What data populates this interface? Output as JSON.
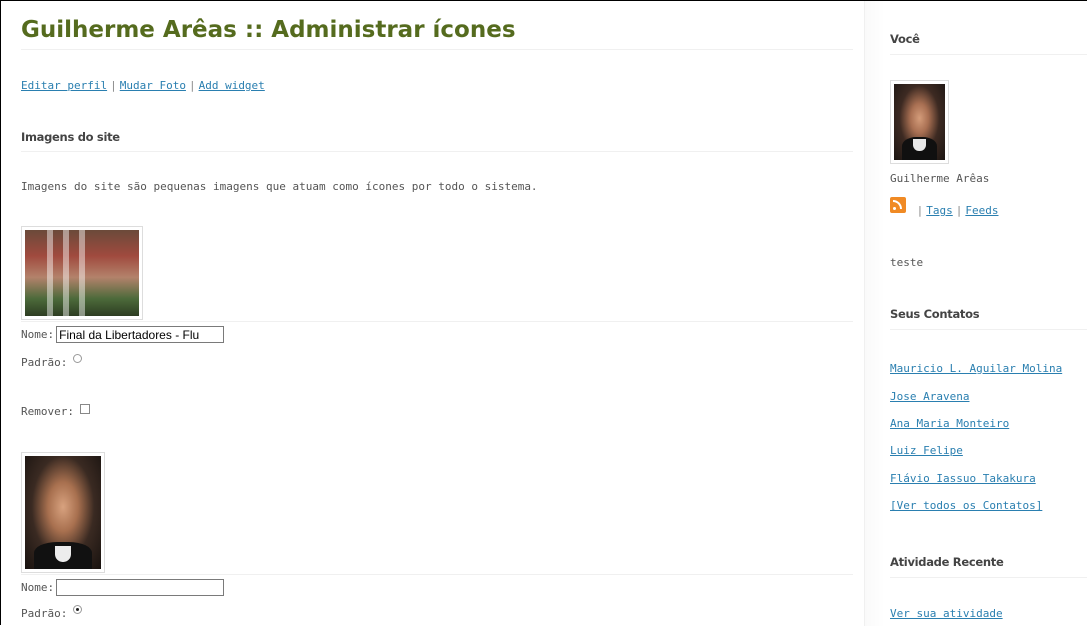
{
  "page": {
    "title": "Guilherme Arêas :: Administrar ícones"
  },
  "toplinks": {
    "edit_profile": "Editar perfil",
    "change_photo": "Mudar Foto",
    "add_widget": "Add widget",
    "separator": "|"
  },
  "section": {
    "title": "Imagens do site",
    "description": "Imagens do site são pequenas imagens que atuam como ícones por todo o sistema."
  },
  "icons": [
    {
      "name_label": "Nome:",
      "name_value": "Final da Libertadores - Flu",
      "default_label": "Padrão:",
      "default_checked": false,
      "remove_label": "Remover:"
    },
    {
      "name_label": "Nome:",
      "name_value": "",
      "default_label": "Padrão:",
      "default_checked": true
    }
  ],
  "sidebar": {
    "you_title": "Você",
    "user_name": "Guilherme Arêas",
    "tags_link": "Tags",
    "feeds_link": "Feeds",
    "separator": "|",
    "status_text": "teste",
    "contacts_title": "Seus Contatos",
    "contacts": [
      "Mauricio L. Aguilar Molina",
      "Jose Aravena",
      "Ana Maria Monteiro",
      "Luiz Felipe",
      "Flávio Iassuo Takakura",
      "[Ver todos os Contatos]"
    ],
    "activity_title": "Atividade Recente",
    "activity_link": "Ver sua atividade"
  },
  "colors": {
    "title": "#556b1e",
    "link": "#2a7fb0",
    "text": "#555555",
    "rss": "#f08a24"
  },
  "icon_names": [
    "rss-icon",
    "radio-button",
    "checkbox"
  ]
}
